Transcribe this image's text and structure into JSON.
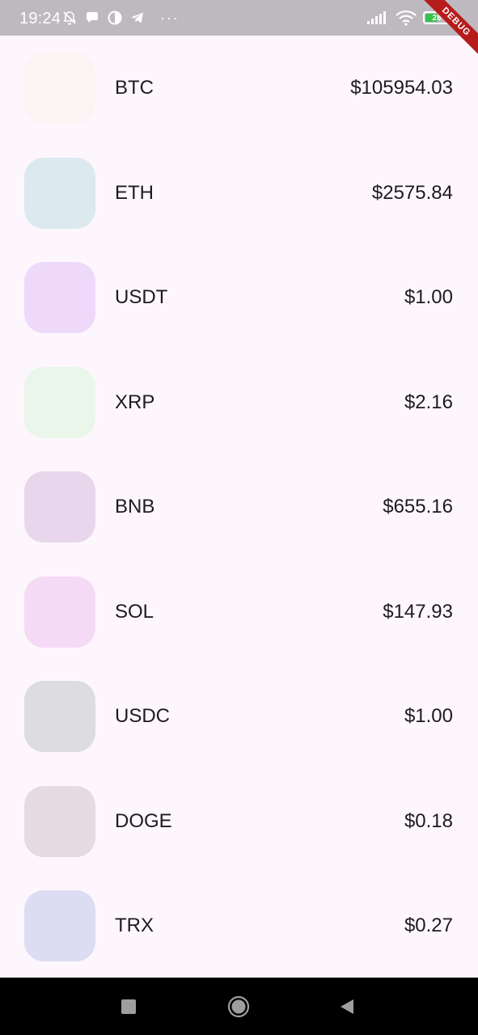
{
  "status_bar": {
    "time": "19:24",
    "battery_level": "28",
    "more_indicator": "···",
    "icons": [
      "mute-bell-icon",
      "chat-bubble-icon",
      "data-saver-icon",
      "telegram-icon",
      "signal-icon",
      "wifi-icon",
      "battery-icon"
    ]
  },
  "debug_banner": "DEBUG",
  "coins": [
    {
      "symbol": "BTC",
      "price": "$105954.03",
      "color": "#fcf3f4"
    },
    {
      "symbol": "ETH",
      "price": "$2575.84",
      "color": "#dce9ef"
    },
    {
      "symbol": "USDT",
      "price": "$1.00",
      "color": "#eed9fb"
    },
    {
      "symbol": "XRP",
      "price": "$2.16",
      "color": "#e9f6e9"
    },
    {
      "symbol": "BNB",
      "price": "$655.16",
      "color": "#e8d7ec"
    },
    {
      "symbol": "SOL",
      "price": "$147.93",
      "color": "#f5daf6"
    },
    {
      "symbol": "USDC",
      "price": "$1.00",
      "color": "#dddcde"
    },
    {
      "symbol": "DOGE",
      "price": "$0.18",
      "color": "#e5dbe1"
    },
    {
      "symbol": "TRX",
      "price": "$0.27",
      "color": "#dcdcf2"
    }
  ],
  "nav": {
    "icons": [
      "recents-square-icon",
      "home-circle-icon",
      "back-triangle-icon"
    ]
  }
}
